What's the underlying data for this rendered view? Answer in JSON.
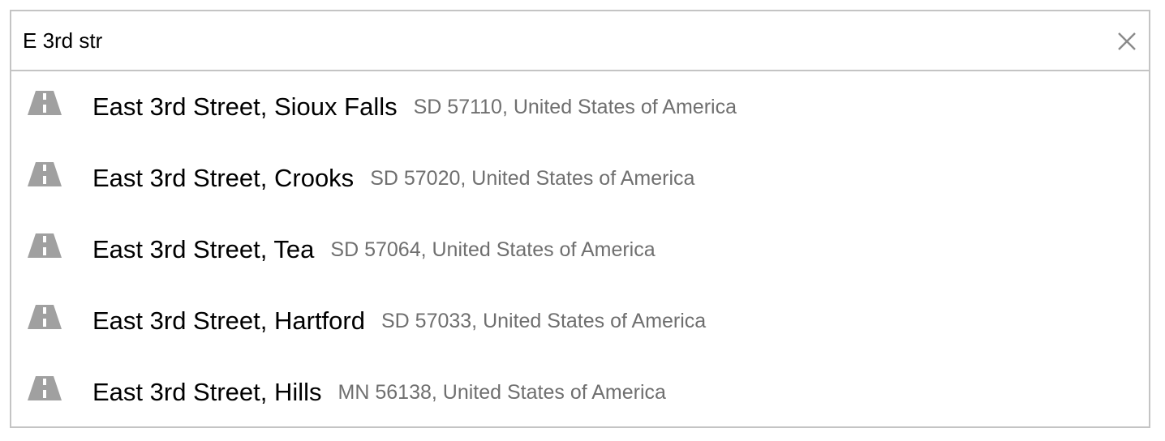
{
  "search": {
    "value": "E 3rd str",
    "clear_icon": "close-icon"
  },
  "colors": {
    "border": "#c4c4c4",
    "primary_text": "#000000",
    "secondary_text": "#6f6f6f",
    "icon": "#a0a0a0"
  },
  "results": [
    {
      "icon": "road-icon",
      "primary": "East 3rd Street, Sioux Falls",
      "secondary": "SD 57110, United States of America"
    },
    {
      "icon": "road-icon",
      "primary": "East 3rd Street, Crooks",
      "secondary": "SD 57020, United States of America"
    },
    {
      "icon": "road-icon",
      "primary": "East 3rd Street, Tea",
      "secondary": "SD 57064, United States of America"
    },
    {
      "icon": "road-icon",
      "primary": "East 3rd Street, Hartford",
      "secondary": "SD 57033, United States of America"
    },
    {
      "icon": "road-icon",
      "primary": "East 3rd Street, Hills",
      "secondary": "MN 56138, United States of America"
    }
  ]
}
